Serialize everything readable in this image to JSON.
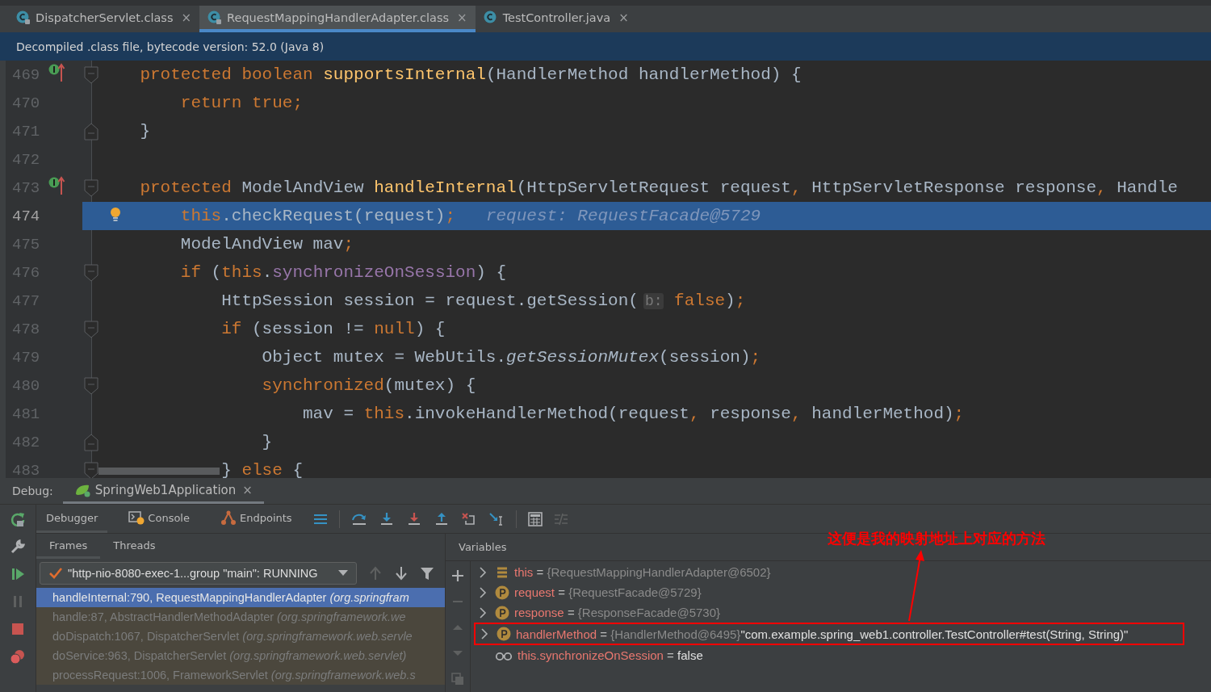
{
  "editor_tabs": [
    {
      "label": "DispatcherServlet.class",
      "locked": true,
      "selected": false,
      "close": "×"
    },
    {
      "label": "RequestMappingHandlerAdapter.class",
      "locked": true,
      "selected": true,
      "close": "×"
    },
    {
      "label": "TestController.java",
      "locked": false,
      "selected": false,
      "close": "×"
    }
  ],
  "info_bar": "Decompiled .class file, bytecode version: 52.0 (Java 8)",
  "code_lines": [
    {
      "number": "469",
      "overrides": true,
      "fold_start": true,
      "fold_end": false,
      "current": false,
      "tokens": [
        {
          "kind": "kw",
          "text": "    protected boolean "
        },
        {
          "kind": "fn",
          "text": "supportsInternal"
        },
        {
          "kind": "p",
          "text": "(HandlerMethod handlerMethod) {"
        }
      ]
    },
    {
      "number": "470",
      "overrides": false,
      "fold_start": false,
      "fold_end": false,
      "current": false,
      "tokens": [
        {
          "kind": "kw",
          "text": "        return true;"
        }
      ]
    },
    {
      "number": "471",
      "overrides": false,
      "fold_start": false,
      "fold_end": true,
      "current": false,
      "tokens": [
        {
          "kind": "p",
          "text": "    }"
        }
      ]
    },
    {
      "number": "472",
      "overrides": false,
      "fold_start": false,
      "fold_end": false,
      "current": false
    },
    {
      "number": "473",
      "overrides": true,
      "fold_start": true,
      "fold_end": false,
      "current": false,
      "tokens": [
        {
          "kind": "kw",
          "text": "    protected "
        },
        {
          "kind": "p",
          "text": "ModelAndView "
        },
        {
          "kind": "fn",
          "text": "handleInternal"
        },
        {
          "kind": "p",
          "text": "(HttpServletRequest request"
        },
        {
          "kind": "kw",
          "text": ", "
        },
        {
          "kind": "p",
          "text": "HttpServletResponse response"
        },
        {
          "kind": "kw",
          "text": ", "
        },
        {
          "kind": "p",
          "text": "Handle"
        }
      ]
    },
    {
      "number": "474",
      "overrides": false,
      "fold_start": false,
      "fold_end": false,
      "current": true,
      "tokens": [
        {
          "kind": "kw",
          "text": "        this"
        },
        {
          "kind": "p",
          "text": ".checkRequest(request)"
        },
        {
          "kind": "kw",
          "text": ";"
        },
        {
          "kind": "iv",
          "text": "   request: RequestFacade@5729"
        }
      ]
    },
    {
      "number": "475",
      "overrides": false,
      "fold_start": false,
      "fold_end": false,
      "current": false,
      "tokens": [
        {
          "kind": "p",
          "text": "        ModelAndView mav"
        },
        {
          "kind": "kw",
          "text": ";"
        }
      ]
    },
    {
      "number": "476",
      "overrides": false,
      "fold_start": true,
      "fold_end": false,
      "current": false,
      "tokens": [
        {
          "kind": "kw",
          "text": "        if "
        },
        {
          "kind": "p",
          "text": "("
        },
        {
          "kind": "kw",
          "text": "this"
        },
        {
          "kind": "p",
          "text": "."
        },
        {
          "kind": "fd",
          "text": "synchronizeOnSession"
        },
        {
          "kind": "p",
          "text": ") {"
        }
      ]
    },
    {
      "number": "477",
      "overrides": false,
      "fold_start": false,
      "fold_end": false,
      "current": false,
      "tokens": [
        {
          "kind": "p",
          "text": "            HttpSession session = request.getSession("
        },
        {
          "kind": "hint",
          "text": "b:"
        },
        {
          "kind": "kw",
          "text": " false"
        },
        {
          "kind": "p",
          "text": ")"
        },
        {
          "kind": "kw",
          "text": ";"
        }
      ]
    },
    {
      "number": "478",
      "overrides": false,
      "fold_start": true,
      "fold_end": false,
      "current": false,
      "tokens": [
        {
          "kind": "kw",
          "text": "            if "
        },
        {
          "kind": "p",
          "text": "(session != "
        },
        {
          "kind": "kw",
          "text": "null"
        },
        {
          "kind": "p",
          "text": ") {"
        }
      ]
    },
    {
      "number": "479",
      "overrides": false,
      "fold_start": false,
      "fold_end": false,
      "current": false,
      "tokens": [
        {
          "kind": "p",
          "text": "                Object mutex = WebUtils."
        },
        {
          "kind": "it",
          "text": "getSessionMutex"
        },
        {
          "kind": "p",
          "text": "(session)"
        },
        {
          "kind": "kw",
          "text": ";"
        }
      ]
    },
    {
      "number": "480",
      "overrides": false,
      "fold_start": true,
      "fold_end": false,
      "current": false,
      "tokens": [
        {
          "kind": "kw",
          "text": "                synchronized"
        },
        {
          "kind": "p",
          "text": "(mutex) {"
        }
      ]
    },
    {
      "number": "481",
      "overrides": false,
      "fold_start": false,
      "fold_end": false,
      "current": false,
      "tokens": [
        {
          "kind": "p",
          "text": "                    mav = "
        },
        {
          "kind": "kw",
          "text": "this"
        },
        {
          "kind": "p",
          "text": ".invokeHandlerMethod(request"
        },
        {
          "kind": "kw",
          "text": ", "
        },
        {
          "kind": "p",
          "text": "response"
        },
        {
          "kind": "kw",
          "text": ", "
        },
        {
          "kind": "p",
          "text": "handlerMethod)"
        },
        {
          "kind": "kw",
          "text": ";"
        }
      ]
    },
    {
      "number": "482",
      "overrides": false,
      "fold_start": false,
      "fold_end": true,
      "current": false,
      "tokens": [
        {
          "kind": "p",
          "text": "                }"
        }
      ]
    },
    {
      "number": "483",
      "overrides": false,
      "fold_start": true,
      "fold_end": false,
      "current": false,
      "tokens": [
        {
          "kind": "p",
          "text": "            } "
        },
        {
          "kind": "kw",
          "text": "else "
        },
        {
          "kind": "p",
          "text": "{"
        }
      ]
    }
  ],
  "debug": {
    "label": "Debug:",
    "session": "SpringWeb1Application",
    "session_close": "×",
    "tabs": [
      {
        "label": "Debugger",
        "kind": "debugger",
        "selected": true
      },
      {
        "label": "Console",
        "kind": "console",
        "selected": false
      },
      {
        "label": "Endpoints",
        "kind": "endpoints",
        "selected": false
      }
    ],
    "frame_tabs": [
      {
        "label": "Frames",
        "selected": true
      },
      {
        "label": "Threads",
        "selected": false
      }
    ],
    "thread": "\"http-nio-8080-exec-1...group \"main\": RUNNING",
    "frames": [
      {
        "method": "handleInternal:790, RequestMappingHandlerAdapter",
        "package": "(org.springfram",
        "selected": true
      },
      {
        "method": "handle:87, AbstractHandlerMethodAdapter",
        "package": "(org.springframework.we",
        "selected": false
      },
      {
        "method": "doDispatch:1067, DispatcherServlet",
        "package": "(org.springframework.web.servle",
        "selected": false
      },
      {
        "method": "doService:963, DispatcherServlet",
        "package": "(org.springframework.web.servlet)",
        "selected": false
      },
      {
        "method": "processRequest:1006, FrameworkServlet",
        "package": "(org.springframework.web.s",
        "selected": false
      }
    ],
    "variables_title": "Variables",
    "variables": [
      {
        "kind": "object",
        "expandable": true,
        "name": "this",
        "operator": "=",
        "value": "{RequestMappingHandlerAdapter@6502}",
        "highlighted": false
      },
      {
        "kind": "param",
        "expandable": true,
        "name": "request",
        "operator": "=",
        "value": "{RequestFacade@5729}",
        "highlighted": false
      },
      {
        "kind": "param",
        "expandable": true,
        "name": "response",
        "operator": "=",
        "value": "{ResponseFacade@5730}",
        "highlighted": false
      },
      {
        "kind": "param",
        "expandable": true,
        "name": "handlerMethod",
        "operator": "=",
        "value": "{HandlerMethod@6495}",
        "string": "\"com.example.spring_web1.controller.TestController#test(String, String)\"",
        "highlighted": true
      },
      {
        "kind": "watch",
        "expandable": false,
        "name": "this.synchronizeOnSession",
        "operator": "=",
        "string": "false",
        "highlighted": false
      }
    ],
    "annotation": "这便是我的映射地址上对应的方法"
  }
}
